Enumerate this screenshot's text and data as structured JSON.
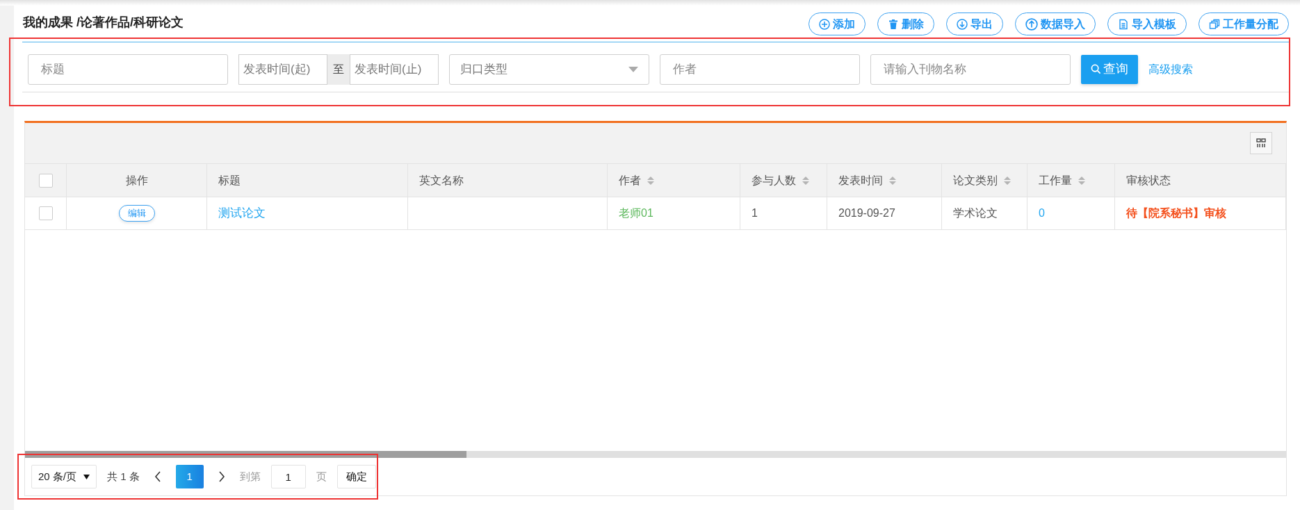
{
  "breadcrumb": "我的成果 /论著作品/科研论文",
  "toolbar_buttons": [
    {
      "kind": "plus",
      "label": "添加"
    },
    {
      "kind": "trash",
      "label": "删除"
    },
    {
      "kind": "download",
      "label": "导出"
    },
    {
      "kind": "upload",
      "label": "数据导入"
    },
    {
      "kind": "file",
      "label": "导入模板"
    },
    {
      "kind": "stack",
      "label": "工作量分配"
    }
  ],
  "filters": {
    "title": {
      "placeholder": "标题"
    },
    "date_start": {
      "placeholder": "发表时间(起)"
    },
    "date_separator": "至",
    "date_end": {
      "placeholder": "发表时间(止)"
    },
    "category": {
      "placeholder": "归口类型"
    },
    "author": {
      "placeholder": "作者"
    },
    "journal": {
      "placeholder": "请输入刊物名称"
    },
    "search_button": "查询",
    "advanced_link": "高级搜索"
  },
  "table": {
    "select_all_checked": false,
    "columns": [
      {
        "label": "操作",
        "sortable": false
      },
      {
        "label": "标题",
        "sortable": false
      },
      {
        "label": "英文名称",
        "sortable": false
      },
      {
        "label": "作者",
        "sortable": true
      },
      {
        "label": "参与人数",
        "sortable": true
      },
      {
        "label": "发表时间",
        "sortable": true
      },
      {
        "label": "论文类别",
        "sortable": true
      },
      {
        "label": "工作量",
        "sortable": true
      },
      {
        "label": "审核状态",
        "sortable": false
      }
    ],
    "rows": [
      {
        "checked": false,
        "action": "编辑",
        "title": "测试论文",
        "author": "老师01",
        "participants": "1",
        "date": "2019-09-27",
        "type": "学术论文",
        "workload": "0",
        "status": "待【院系秘书】审核"
      }
    ]
  },
  "pagination": {
    "page_size": "20 条/页",
    "total": "共 1 条",
    "pages": [
      {
        "label": "1",
        "selected": true
      }
    ],
    "goto_label": "到第",
    "goto_value": "1",
    "page_unit": "页",
    "confirm": "确定"
  }
}
